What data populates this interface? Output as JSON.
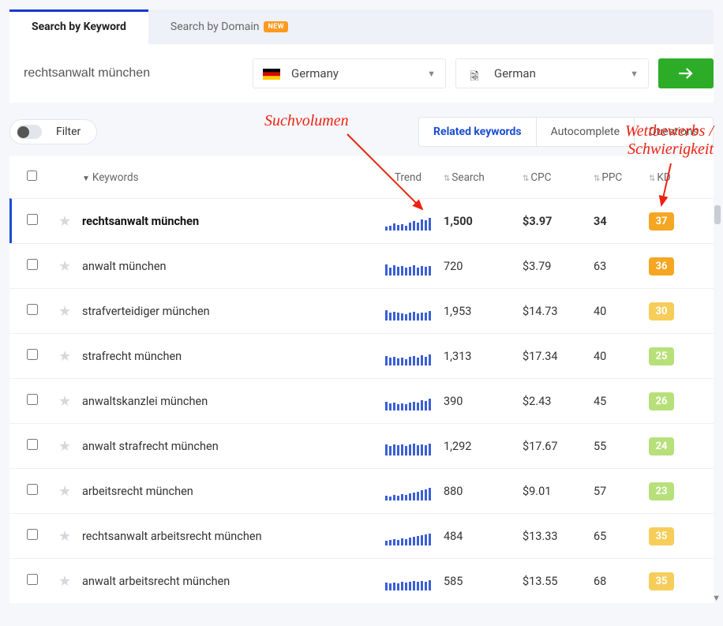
{
  "tabs": {
    "keyword": "Search by Keyword",
    "domain": "Search by Domain",
    "new_badge": "NEW"
  },
  "search": {
    "value": "rechtsanwalt münchen",
    "country": "Germany",
    "language": "German"
  },
  "filter_label": "Filter",
  "result_tabs": {
    "related": "Related keywords",
    "autocomplete": "Autocomplete",
    "questions": "Questions"
  },
  "columns": {
    "keywords": "Keywords",
    "trend": "Trend",
    "search": "Search",
    "cpc": "CPC",
    "ppc": "PPC",
    "kd": "KD"
  },
  "annotations": {
    "volume": "Suchvolumen",
    "difficulty1": "Wettbewerbs /",
    "difficulty2": "Schwierigkeit"
  },
  "rows": [
    {
      "keyword": "rechtsanwalt münchen",
      "search": "1,500",
      "cpc": "$3.97",
      "ppc": "34",
      "kd": "37",
      "kd_color": "#f5a623",
      "active": true,
      "trend": [
        5,
        6,
        9,
        7,
        8,
        6,
        10,
        12,
        10,
        14,
        13,
        16
      ]
    },
    {
      "keyword": "anwalt münchen",
      "search": "720",
      "cpc": "$3.79",
      "ppc": "63",
      "kd": "36",
      "kd_color": "#f5a623",
      "active": false,
      "trend": [
        14,
        10,
        13,
        11,
        12,
        10,
        11,
        13,
        10,
        12,
        11,
        12
      ]
    },
    {
      "keyword": "strafverteidiger münchen",
      "search": "1,953",
      "cpc": "$14.73",
      "ppc": "40",
      "kd": "30",
      "kd_color": "#f7cd5a",
      "active": false,
      "trend": [
        13,
        10,
        11,
        10,
        9,
        8,
        10,
        11,
        9,
        10,
        10,
        12
      ]
    },
    {
      "keyword": "strafrecht münchen",
      "search": "1,313",
      "cpc": "$17.34",
      "ppc": "40",
      "kd": "25",
      "kd_color": "#b7e07a",
      "active": false,
      "trend": [
        12,
        10,
        11,
        9,
        10,
        8,
        11,
        12,
        10,
        13,
        11,
        14
      ]
    },
    {
      "keyword": "anwaltskanzlei münchen",
      "search": "390",
      "cpc": "$2.43",
      "ppc": "45",
      "kd": "26",
      "kd_color": "#b7e07a",
      "active": false,
      "trend": [
        11,
        9,
        10,
        8,
        9,
        8,
        10,
        11,
        10,
        13,
        12,
        15
      ]
    },
    {
      "keyword": "anwalt strafrecht münchen",
      "search": "1,292",
      "cpc": "$17.67",
      "ppc": "55",
      "kd": "24",
      "kd_color": "#b7e07a",
      "active": false,
      "trend": [
        14,
        12,
        14,
        13,
        14,
        12,
        14,
        15,
        13,
        14,
        13,
        15
      ]
    },
    {
      "keyword": "arbeitsrecht münchen",
      "search": "880",
      "cpc": "$9.01",
      "ppc": "57",
      "kd": "23",
      "kd_color": "#b7e07a",
      "active": false,
      "trend": [
        6,
        5,
        7,
        6,
        8,
        7,
        9,
        10,
        11,
        13,
        14,
        16
      ]
    },
    {
      "keyword": "rechtsanwalt arbeitsrecht münchen",
      "search": "484",
      "cpc": "$13.33",
      "ppc": "65",
      "kd": "35",
      "kd_color": "#f7cd5a",
      "active": false,
      "trend": [
        6,
        7,
        8,
        7,
        9,
        8,
        10,
        11,
        12,
        13,
        14,
        15
      ]
    },
    {
      "keyword": "anwalt arbeitsrecht münchen",
      "search": "585",
      "cpc": "$13.55",
      "ppc": "68",
      "kd": "35",
      "kd_color": "#f7cd5a",
      "active": false,
      "trend": [
        10,
        9,
        10,
        9,
        11,
        10,
        11,
        12,
        11,
        12,
        11,
        13
      ]
    }
  ]
}
